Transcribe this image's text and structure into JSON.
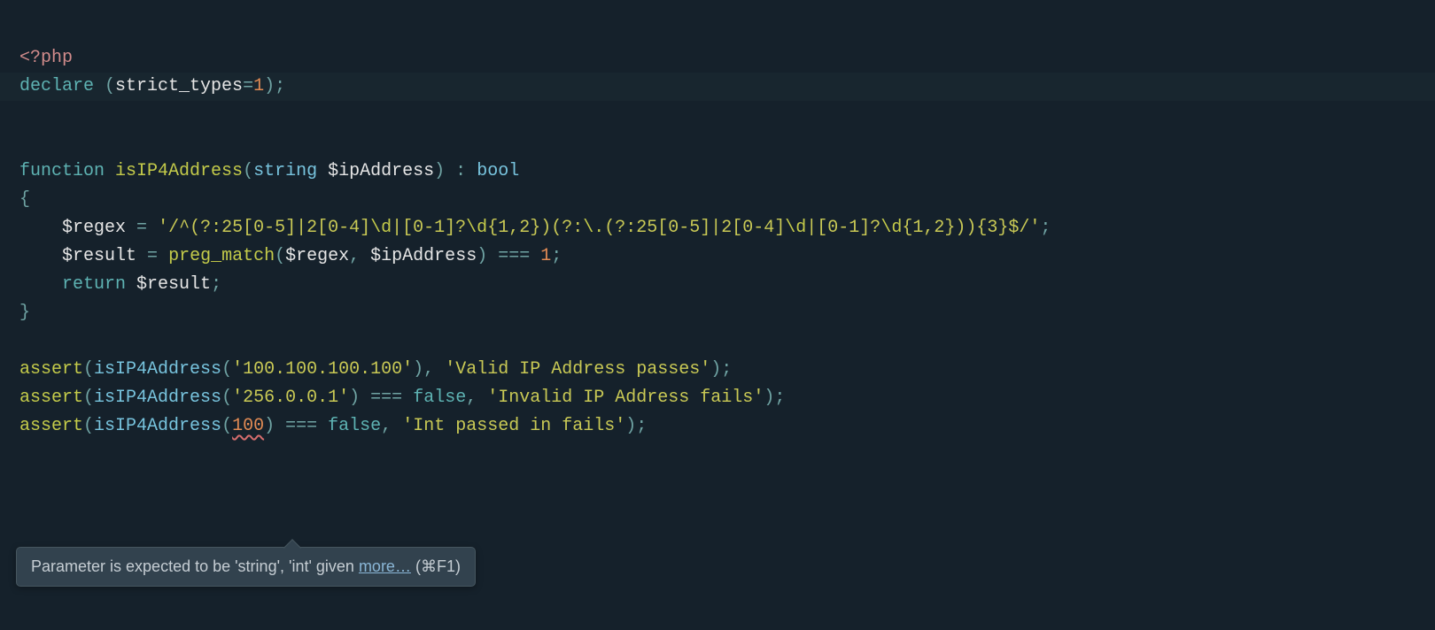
{
  "line1": {
    "open": "<?php"
  },
  "line2": {
    "kw": "declare",
    "op1": " (",
    "arg": "strict_types",
    "eq": "=",
    "num": "1",
    "cl": ")",
    "sc": ";"
  },
  "line4": {
    "kw": "function",
    "sp1": " ",
    "name": "isIP4Address",
    "op": "(",
    "type": "string",
    "sp2": " ",
    "var": "$ipAddress",
    "cp": ")",
    "sp3": " ",
    "colon": ":",
    "sp4": " ",
    "ret": "bool"
  },
  "line5": {
    "brace": "{"
  },
  "line6": {
    "indent": "    ",
    "var": "$regex",
    "sp": " ",
    "eq": "=",
    "sp2": " ",
    "q1": "'",
    "s1": "/^(?:25[0-5]|2[0-4]",
    "e1": "\\d",
    "s2": "|[0-1]?",
    "e2": "\\d",
    "s3": "{1,2})(?:",
    "e3": "\\.",
    "s4": "(?:25[0-5]|2[0-4]",
    "e4": "\\d",
    "s5": "|[0-1]?",
    "e5": "\\d",
    "s6": "{1,2})){3}$/",
    "q2": "'",
    "sc": ";"
  },
  "line7": {
    "indent": "    ",
    "var": "$result",
    "sp": " ",
    "eq": "=",
    "sp2": " ",
    "fn": "preg_match",
    "op": "(",
    "a1": "$regex",
    "cm": ",",
    "sp3": " ",
    "a2": "$ipAddress",
    "cp": ")",
    "sp4": " ",
    "eqq": "===",
    "sp5": " ",
    "num": "1",
    "sc": ";"
  },
  "line8": {
    "indent": "    ",
    "kw": "return",
    "sp": " ",
    "var": "$result",
    "sc": ";"
  },
  "line9": {
    "brace": "}"
  },
  "line11": {
    "fn1": "assert",
    "op": "(",
    "fn2": "isIP4Address",
    "op2": "(",
    "q1": "'",
    "s": "100.100.100.100",
    "q2": "'",
    "cp2": ")",
    "cm": ",",
    "sp": " ",
    "q3": "'",
    "msg": "Valid IP Address passes",
    "q4": "'",
    "cp": ")",
    "sc": ";"
  },
  "line12": {
    "fn1": "assert",
    "op": "(",
    "fn2": "isIP4Address",
    "op2": "(",
    "q1": "'",
    "s": "256.0.0.1",
    "q2": "'",
    "cp2": ")",
    "sp1": " ",
    "eqq": "===",
    "sp2": " ",
    "bool": "false",
    "cm": ",",
    "sp3": " ",
    "q3": "'",
    "msg": "Invalid IP Address fails",
    "q4": "'",
    "cp": ")",
    "sc": ";"
  },
  "line13": {
    "fn1": "assert",
    "op": "(",
    "fn2": "isIP4Address",
    "op2": "(",
    "num": "100",
    "cp2": ")",
    "sp1": " ",
    "eqq": "===",
    "sp2": " ",
    "bool": "false",
    "cm": ",",
    "sp3": " ",
    "q3": "'",
    "msg": "Int passed in fails",
    "q4": "'",
    "cp": ")",
    "sc": ";"
  },
  "tooltip": {
    "text": "Parameter is expected to be 'string', 'int' given ",
    "link": "more…",
    "shortcut": " (⌘F1)"
  }
}
